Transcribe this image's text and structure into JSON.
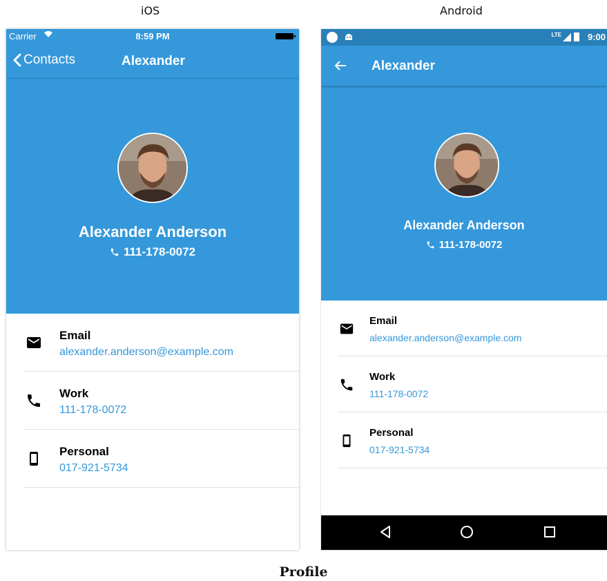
{
  "labels": {
    "ios": "iOS",
    "android": "Android",
    "caption": "Profile"
  },
  "colors": {
    "accent": "#3498db",
    "android_status": "#2980b9",
    "link": "#3498db"
  },
  "ios": {
    "status": {
      "carrier": "Carrier",
      "time": "8:59 PM"
    },
    "nav": {
      "back_label": "Contacts",
      "title": "Alexander"
    },
    "profile": {
      "name": "Alexander Anderson",
      "phone": "111-178-0072"
    },
    "rows": [
      {
        "icon": "mail-icon",
        "label": "Email",
        "value": "alexander.anderson@example.com"
      },
      {
        "icon": "phone-icon",
        "label": "Work",
        "value": "111-178-0072"
      },
      {
        "icon": "smartphone-icon",
        "label": "Personal",
        "value": "017-921-5734"
      }
    ]
  },
  "android": {
    "status": {
      "network": "LTE",
      "time": "9:00"
    },
    "toolbar": {
      "title": "Alexander"
    },
    "profile": {
      "name": "Alexander Anderson",
      "phone": "111-178-0072"
    },
    "rows": [
      {
        "icon": "mail-icon",
        "label": "Email",
        "value": "alexander.anderson@example.com"
      },
      {
        "icon": "phone-icon",
        "label": "Work",
        "value": "111-178-0072"
      },
      {
        "icon": "smartphone-icon",
        "label": "Personal",
        "value": "017-921-5734"
      }
    ],
    "navbar": {
      "buttons": [
        "back-icon",
        "home-icon",
        "recents-icon"
      ]
    }
  }
}
